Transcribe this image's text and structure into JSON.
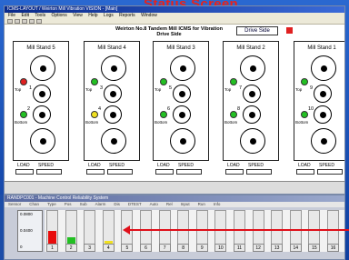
{
  "banner": "Status Screen",
  "app": {
    "title": "ICMS-LAYOUT / Weirton Mill Vibration VISION - [Main]",
    "menus": [
      "File",
      "Edit",
      "Tools",
      "Options",
      "View",
      "Help",
      "Logs",
      "Reports",
      "Window"
    ]
  },
  "header": {
    "title_line1": "Weirton No.8 Tandem Mill ICMS for Vibration",
    "title_line2": "Drive Side",
    "drive_side_button": "Drive Side",
    "status_color": "#e02020"
  },
  "stands": [
    {
      "name": "Mill Stand 5",
      "top_num": "1",
      "bottom_num": "2",
      "top_color": "#e02020",
      "bottom_color": "#22c022"
    },
    {
      "name": "Mill Stand 4",
      "top_num": "3",
      "bottom_num": "4",
      "top_color": "#22c022",
      "bottom_color": "#f0e020"
    },
    {
      "name": "Mill Stand 3",
      "top_num": "5",
      "bottom_num": "6",
      "top_color": "#22c022",
      "bottom_color": "#22c022"
    },
    {
      "name": "Mill Stand 2",
      "top_num": "7",
      "bottom_num": "8",
      "top_color": "#22c022",
      "bottom_color": "#22c022"
    },
    {
      "name": "Mill Stand 1",
      "top_num": "9",
      "bottom_num": "10",
      "top_color": "#22c022",
      "bottom_color": "#22c022"
    }
  ],
  "labels": {
    "top": "Top",
    "bottom": "Bottom",
    "load": "LOAD",
    "speed": "SPEED"
  },
  "bottom": {
    "title": "RANDPC001 - Machine Control Reliability System",
    "menu": [
      "Sensor",
      "Chan",
      "Type",
      "Pos",
      "Sub",
      "Alarm",
      "Dis",
      "DTEST",
      "Auto",
      "Rel",
      "Input",
      "Run",
      "Info"
    ],
    "scale": [
      "0.0800",
      "0.0400",
      "0"
    ],
    "left_label": "0",
    "columns": [
      "1",
      "2",
      "3",
      "4",
      "5",
      "6",
      "7",
      "8",
      "9",
      "10",
      "11",
      "12",
      "13",
      "14",
      "15",
      "16"
    ],
    "levels": [
      0.45,
      0.3,
      0.05,
      0.2,
      0.08,
      0.08,
      0.05,
      0.05,
      0.05,
      0.05,
      0.05,
      0.05,
      0.05,
      0.05,
      0.05,
      0.05
    ],
    "colors": [
      "#e80c0c",
      "#22c022",
      "#22c022",
      "#f0e020",
      "#22c022",
      "#22c022",
      "#22c022",
      "#22c022",
      "#22c022",
      "#22c022",
      "#22c022",
      "#22c022",
      "#22c022",
      "#22c022",
      "#22c022",
      "#22c022"
    ]
  }
}
